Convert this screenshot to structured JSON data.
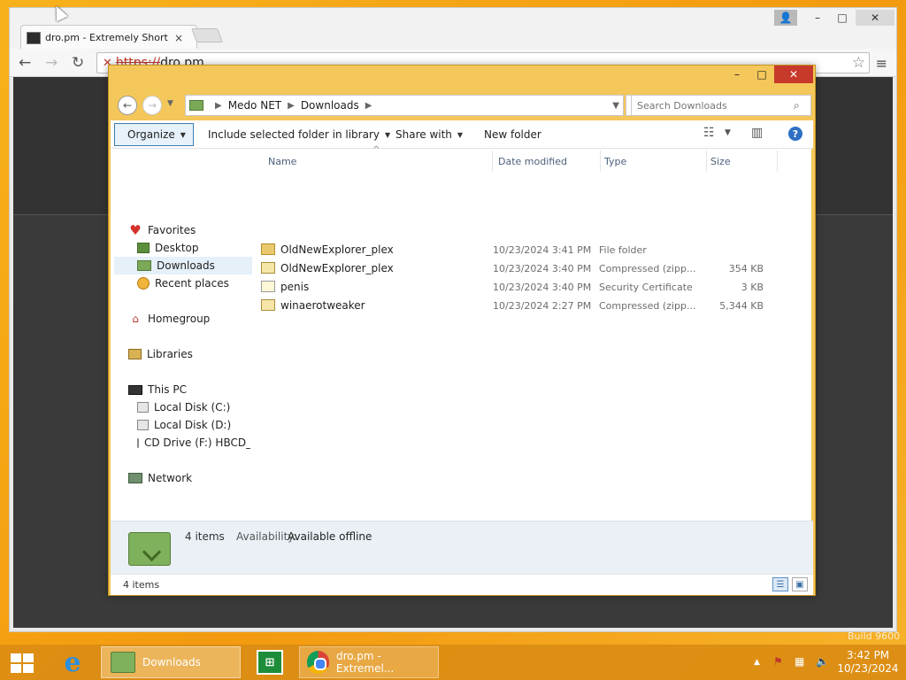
{
  "browser": {
    "tab_title": "dro.pm - Extremely Short Li",
    "tab_close": "×",
    "url_scheme": "https://",
    "url_host": "dro.pm"
  },
  "explorer": {
    "address": {
      "crumbs": [
        "Medo NET",
        "Downloads"
      ]
    },
    "search": {
      "placeholder": "Search Downloads"
    },
    "commands": {
      "organize": "Organize",
      "include": "Include selected folder in library",
      "share": "Share with",
      "new_folder": "New folder"
    },
    "nav": {
      "favorites": "Favorites",
      "desktop": "Desktop",
      "downloads": "Downloads",
      "recent": "Recent places",
      "homegroup": "Homegroup",
      "libraries": "Libraries",
      "this_pc": "This PC",
      "disk_c": "Local Disk (C:)",
      "disk_d": "Local Disk (D:)",
      "cd_drive": "CD Drive (F:) HBCD_P",
      "network": "Network"
    },
    "columns": {
      "name": "Name",
      "date": "Date modified",
      "type": "Type",
      "size": "Size"
    },
    "files": [
      {
        "name": "OldNewExplorer_plex",
        "date": "10/23/2024 3:41 PM",
        "type": "File folder",
        "size": "",
        "icon": "folder"
      },
      {
        "name": "OldNewExplorer_plex",
        "date": "10/23/2024 3:40 PM",
        "type": "Compressed (zipp...",
        "size": "354 KB",
        "icon": "zip"
      },
      {
        "name": "penis",
        "date": "10/23/2024 3:40 PM",
        "type": "Security Certificate",
        "size": "3 KB",
        "icon": "cert"
      },
      {
        "name": "winaerotweaker",
        "date": "10/23/2024 2:27 PM",
        "type": "Compressed (zipp...",
        "size": "5,344 KB",
        "icon": "zip"
      }
    ],
    "details": {
      "count": "4 items",
      "availability_label": "Availability:",
      "availability_value": "Available offline"
    },
    "status": {
      "items": "4 items"
    }
  },
  "taskbar": {
    "downloads_label": "Downloads",
    "chrome_label": "dro.pm - Extremel...",
    "time": "3:42 PM",
    "date": "10/23/2024"
  },
  "watermark": "Build 9600"
}
